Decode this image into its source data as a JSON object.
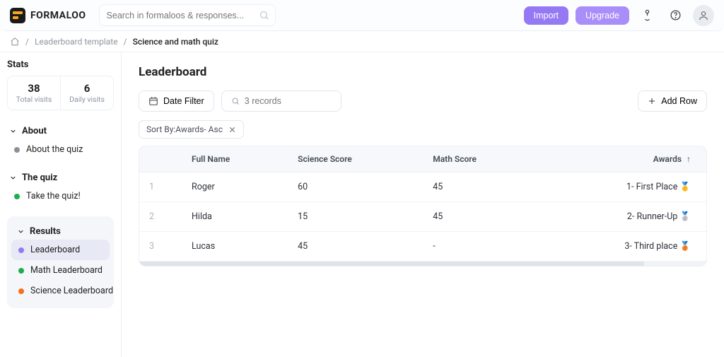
{
  "brand": "FORMALOO",
  "search": {
    "placeholder": "Search in formaloos & responses..."
  },
  "header_buttons": {
    "import": "Import",
    "upgrade": "Upgrade"
  },
  "breadcrumbs": {
    "root": "Leaderboard template",
    "current": "Science and math quiz"
  },
  "stats": {
    "title": "Stats",
    "total": {
      "value": "38",
      "label": "Total visits"
    },
    "daily": {
      "value": "6",
      "label": "Daily visits"
    }
  },
  "sections": {
    "about": {
      "title": "About",
      "item": "About the quiz"
    },
    "quiz": {
      "title": "The quiz",
      "item": "Take the quiz!"
    },
    "results": {
      "title": "Results",
      "items": [
        "Leaderboard",
        "Math Leaderboard",
        "Science Leaderboard"
      ]
    }
  },
  "main": {
    "title": "Leaderboard",
    "date_filter": "Date Filter",
    "records_placeholder": "3 records",
    "add_row": "Add Row",
    "sort_chip": "Sort By:Awards- Asc",
    "columns": {
      "name": "Full Name",
      "science": "Science Score",
      "math": "Math Score",
      "awards": "Awards"
    },
    "rows": [
      {
        "idx": "1",
        "name": "Roger",
        "science": "60",
        "math": "45",
        "award": "1- First Place 🥇"
      },
      {
        "idx": "2",
        "name": "Hilda",
        "science": "15",
        "math": "45",
        "award": "2- Runner-Up 🥈"
      },
      {
        "idx": "3",
        "name": "Lucas",
        "science": "45",
        "math": "-",
        "award": "3- Third place 🥉"
      }
    ]
  }
}
